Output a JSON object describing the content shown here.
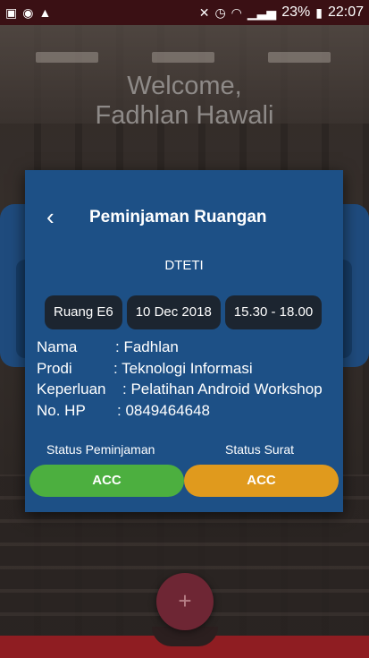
{
  "status_bar": {
    "battery": "23%",
    "time": "22:07"
  },
  "welcome": {
    "line1": "Welcome,",
    "line2": "Fadhlan Hawali"
  },
  "dialog": {
    "title": "Peminjaman Ruangan",
    "department": "DTETI",
    "chips": {
      "room": "Ruang E6",
      "date": "10 Dec 2018",
      "time": "15.30 - 18.00"
    },
    "details": [
      {
        "label": "Nama",
        "value": ": Fadhlan"
      },
      {
        "label": "Prodi",
        "value": ": Teknologi Informasi"
      },
      {
        "label": "Keperluan",
        "value": ": Pelatihan Android Workshop"
      },
      {
        "label": "No. HP",
        "value": ": 0849464648"
      }
    ],
    "status_peminjaman_label": "Status Peminjaman",
    "status_surat_label": "Status Surat",
    "status_peminjaman_value": "ACC",
    "status_surat_value": "ACC",
    "colors": {
      "dialog_bg": "#1d5086",
      "acc_green": "#4caf3f",
      "acc_orange": "#e09a1d"
    }
  },
  "fab": {
    "icon": "plus-icon",
    "label": "+"
  }
}
